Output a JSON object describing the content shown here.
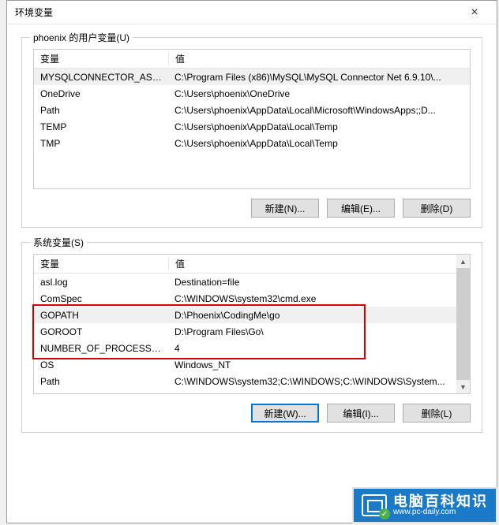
{
  "window": {
    "title": "环境变量",
    "close": "×"
  },
  "user_group": {
    "title": "phoenix 的用户变量(U)",
    "headers": {
      "var": "变量",
      "val": "值"
    },
    "rows": [
      {
        "var": "MYSQLCONNECTOR_ASS...",
        "val": "C:\\Program Files (x86)\\MySQL\\MySQL Connector Net 6.9.10\\..."
      },
      {
        "var": "OneDrive",
        "val": "C:\\Users\\phoenix\\OneDrive"
      },
      {
        "var": "Path",
        "val": "C:\\Users\\phoenix\\AppData\\Local\\Microsoft\\WindowsApps;;D..."
      },
      {
        "var": "TEMP",
        "val": "C:\\Users\\phoenix\\AppData\\Local\\Temp"
      },
      {
        "var": "TMP",
        "val": "C:\\Users\\phoenix\\AppData\\Local\\Temp"
      }
    ],
    "buttons": {
      "new": "新建(N)...",
      "edit": "编辑(E)...",
      "del": "删除(D)"
    }
  },
  "sys_group": {
    "title": "系统变量(S)",
    "headers": {
      "var": "变量",
      "val": "值"
    },
    "rows": [
      {
        "var": "asl.log",
        "val": "Destination=file"
      },
      {
        "var": "ComSpec",
        "val": "C:\\WINDOWS\\system32\\cmd.exe"
      },
      {
        "var": "GOPATH",
        "val": "D:\\Phoenix\\CodingMe\\go"
      },
      {
        "var": "GOROOT",
        "val": "D:\\Program Files\\Go\\"
      },
      {
        "var": "NUMBER_OF_PROCESSORS",
        "val": "4"
      },
      {
        "var": "OS",
        "val": "Windows_NT"
      },
      {
        "var": "Path",
        "val": "C:\\WINDOWS\\system32;C:\\WINDOWS;C:\\WINDOWS\\System..."
      }
    ],
    "buttons": {
      "new": "新建(W)...",
      "edit": "编辑(I)...",
      "del": "删除(L)"
    }
  },
  "watermark": {
    "main": "电脑百科知识",
    "sub": "www.pc-daily.com"
  }
}
